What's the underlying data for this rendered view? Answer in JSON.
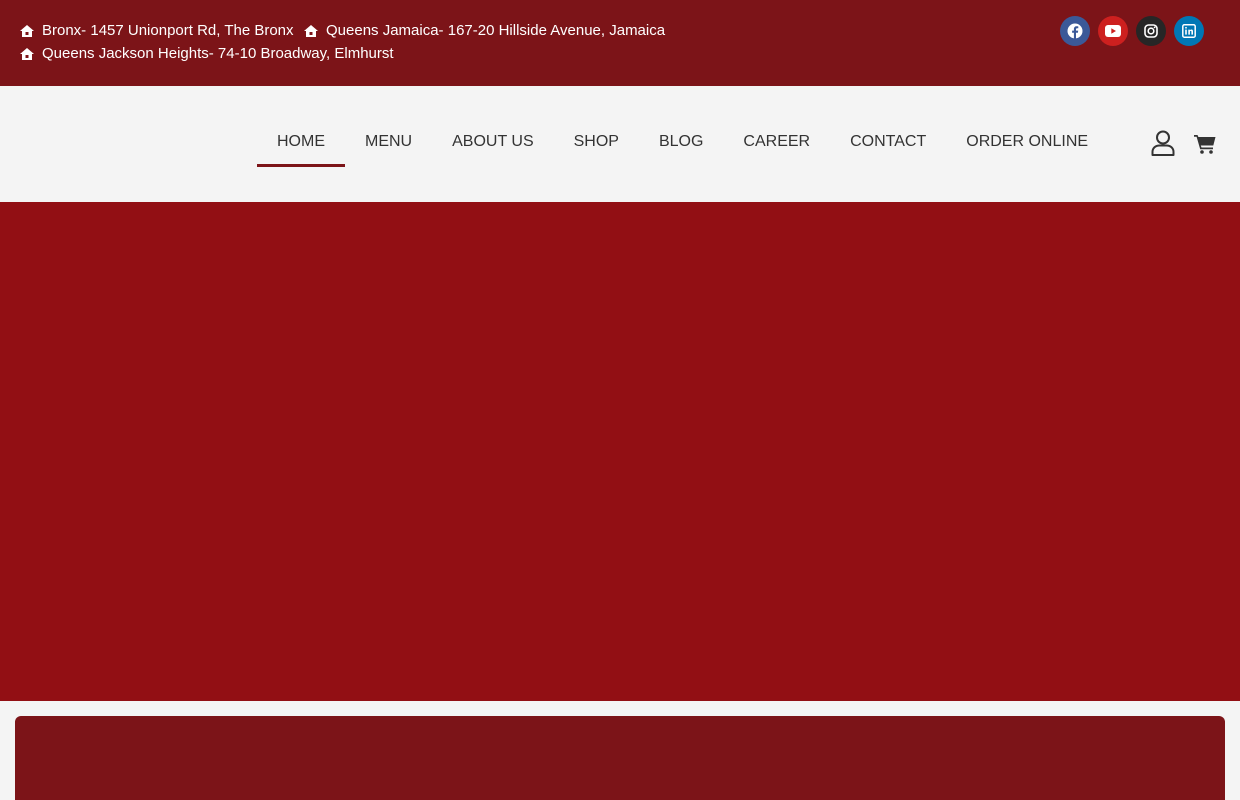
{
  "topbar": {
    "addresses": [
      "Bronx- 1457 Unionport Rd, The Bronx",
      "Queens Jamaica- 167-20 Hillside Avenue, Jamaica",
      "Queens Jackson Heights- 74-10 Broadway, Elmhurst"
    ],
    "address_icon": "home-icon",
    "social": [
      {
        "name": "facebook-icon",
        "color": "#3b5998"
      },
      {
        "name": "youtube-icon",
        "color": "#cd201f"
      },
      {
        "name": "instagram-icon",
        "color": "#262626"
      },
      {
        "name": "linkedin-icon",
        "color": "#0077b5"
      }
    ]
  },
  "nav": {
    "items": [
      "HOME",
      "MENU",
      "ABOUT US",
      "SHOP",
      "BLOG",
      "CAREER",
      "CONTACT",
      "ORDER ONLINE"
    ],
    "active": "HOME"
  },
  "header_icons": [
    "user-icon",
    "shopping-cart-icon"
  ],
  "colors": {
    "topbar": "#7c1418",
    "hero": "#920f14",
    "nav_background": "#f4f4f4",
    "nav_text": "#333333",
    "accent": "#7c1418"
  }
}
